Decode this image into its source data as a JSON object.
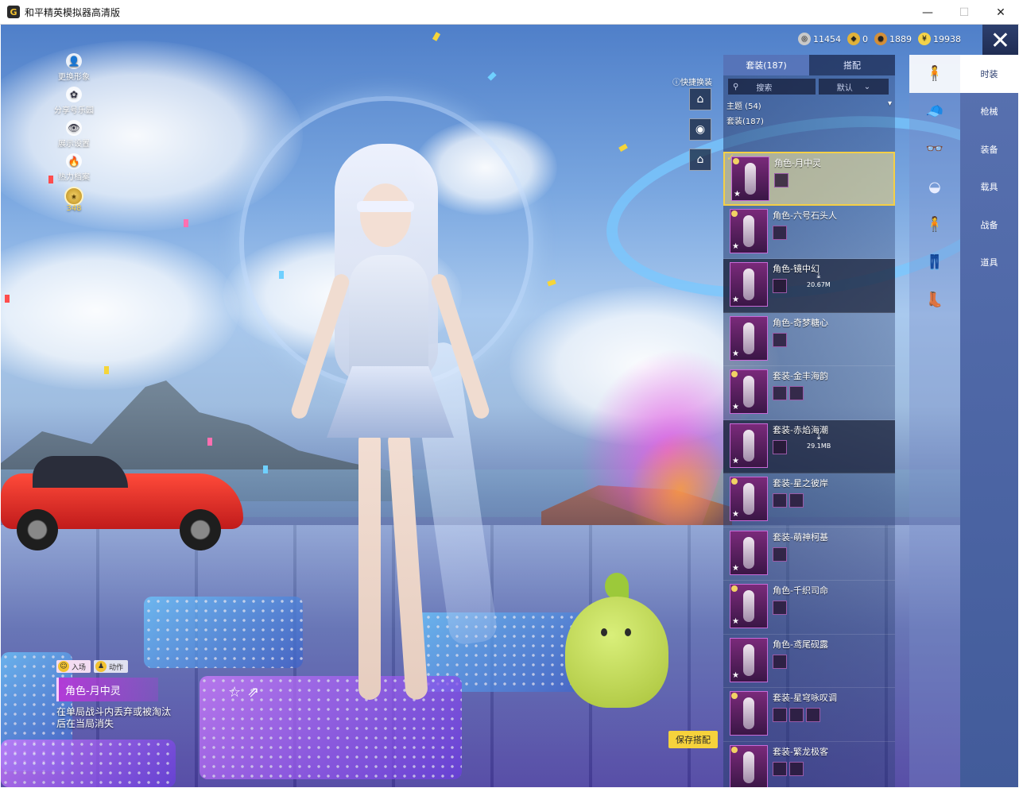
{
  "window": {
    "title": "和平精英模拟器高清版",
    "app_icon": "G",
    "minimize": "—",
    "maximize": "☐",
    "close": "✕"
  },
  "currencies": [
    {
      "icon": "silver-coin-icon",
      "value": "11454",
      "color": "#c9c9c9"
    },
    {
      "icon": "gold-badge-icon",
      "value": "0",
      "color": "#e0b23a"
    },
    {
      "icon": "bronze-coin-icon",
      "value": "1889",
      "color": "#d38f3a"
    },
    {
      "icon": "gold-coin-icon",
      "value": "19938",
      "color": "#f3d24a"
    }
  ],
  "left_menu": [
    {
      "name": "change-appearance",
      "label": "更换形象",
      "icon": "👤"
    },
    {
      "name": "share-code",
      "label": "分享号乐园",
      "icon": "✿"
    },
    {
      "name": "display-settings",
      "label": "展示设置",
      "icon": "👁"
    },
    {
      "name": "heat-record",
      "label": "热力档案",
      "icon": "🔥"
    }
  ],
  "badge": {
    "value": "348"
  },
  "quick_swap": {
    "label": "快捷换装"
  },
  "panel": {
    "tabs": [
      {
        "label": "套装(187)",
        "active": true
      },
      {
        "label": "搭配",
        "active": false
      }
    ],
    "search_placeholder": "搜索",
    "sort_label": "默认",
    "section_theme": "主题 (54)",
    "section_suits": "套装(187)",
    "suits": [
      {
        "name": "角色-月中灵",
        "state": "selected",
        "parts": 1,
        "download": ""
      },
      {
        "name": "角色-六号石头人",
        "state": "normal",
        "parts": 1,
        "download": ""
      },
      {
        "name": "角色-镜中幻",
        "state": "dim",
        "parts": 1,
        "download": "20.67M"
      },
      {
        "name": "角色-奇梦糖心",
        "state": "normal",
        "parts": 1,
        "download": ""
      },
      {
        "name": "套装-金丰海韵",
        "state": "normal",
        "parts": 2,
        "download": ""
      },
      {
        "name": "套装-赤焰海潮",
        "state": "dim",
        "parts": 1,
        "download": "29.1MB"
      },
      {
        "name": "套装-星之彼岸",
        "state": "normal",
        "parts": 2,
        "download": ""
      },
      {
        "name": "套装-萌神柯基",
        "state": "normal",
        "parts": 1,
        "download": ""
      },
      {
        "name": "角色-千织司命",
        "state": "normal",
        "parts": 1,
        "download": ""
      },
      {
        "name": "角色-鸢尾砚露",
        "state": "normal",
        "parts": 1,
        "download": ""
      },
      {
        "name": "套装-星穹咏叹调",
        "state": "normal",
        "parts": 3,
        "download": ""
      },
      {
        "name": "套装-繁龙极客",
        "state": "normal",
        "parts": 2,
        "download": ""
      }
    ]
  },
  "right_tabs": [
    {
      "label": "时装",
      "active": true
    },
    {
      "label": "枪械",
      "active": false
    },
    {
      "label": "装备",
      "active": false
    },
    {
      "label": "载具",
      "active": false
    },
    {
      "label": "战备",
      "active": false
    },
    {
      "label": "道具",
      "active": false
    }
  ],
  "icon_column": [
    {
      "name": "full-outfit-icon",
      "glyph": "🧍",
      "active": true
    },
    {
      "name": "hat-icon",
      "glyph": "🧢",
      "active": false
    },
    {
      "name": "goggles-icon",
      "glyph": "👓",
      "active": false
    },
    {
      "name": "mask-icon",
      "glyph": "◒",
      "active": false
    },
    {
      "name": "top-icon",
      "glyph": "🧍",
      "active": false
    },
    {
      "name": "pants-icon",
      "glyph": "👖",
      "active": false
    },
    {
      "name": "shoes-icon",
      "glyph": "👢",
      "active": false
    }
  ],
  "bottom_info": {
    "tab_enter": "入场",
    "tab_action": "动作",
    "outfit_name": "角色-月中灵",
    "description": "在单局战斗内丢弃或被淘汰后在当局消失"
  },
  "save_button": "保存搭配"
}
